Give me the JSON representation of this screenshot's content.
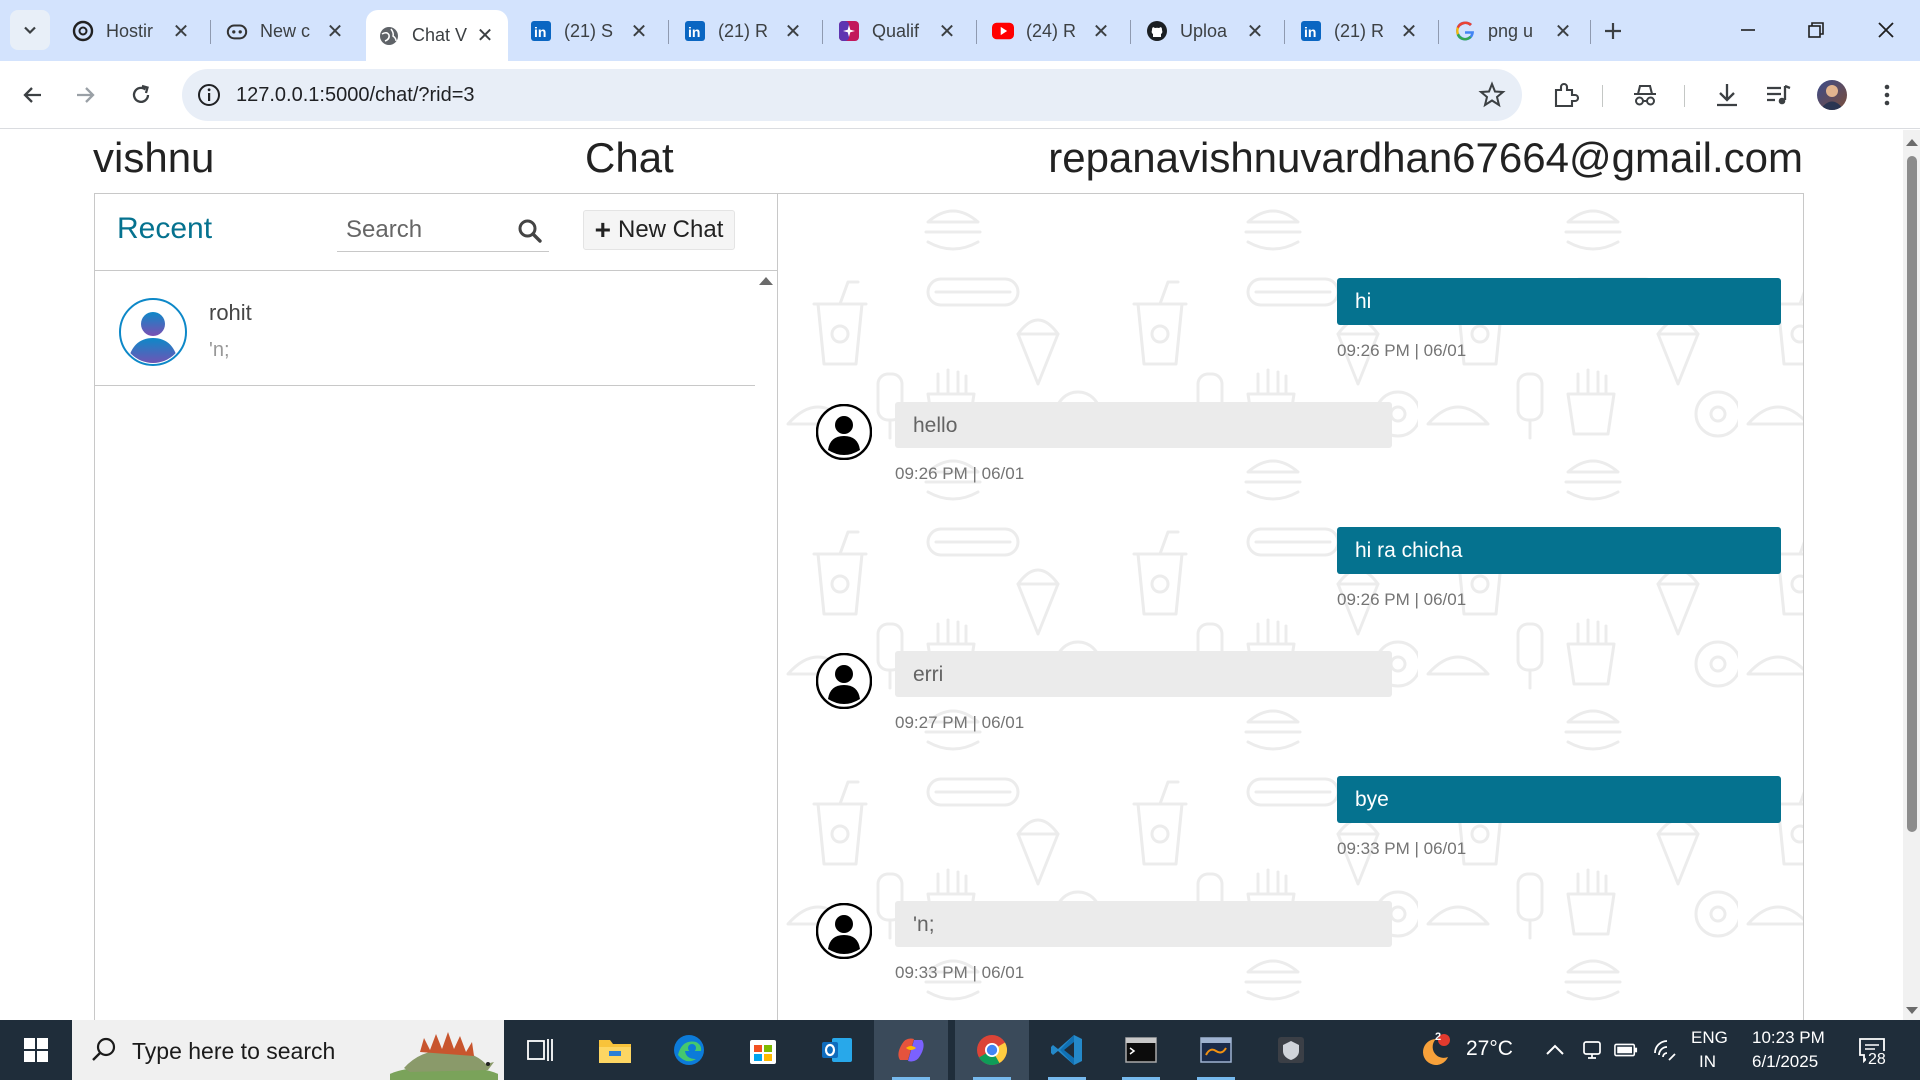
{
  "browser": {
    "tabs": [
      {
        "title": "Hostir",
        "icon": "openai-icon"
      },
      {
        "title": "New c",
        "icon": "copilot-icon"
      },
      {
        "title": "Chat V",
        "icon": "globe-icon",
        "active": true
      },
      {
        "title": "(21) S",
        "icon": "linkedin-icon"
      },
      {
        "title": "(21) R",
        "icon": "linkedin-icon"
      },
      {
        "title": "Qualif",
        "icon": "sparkle-icon"
      },
      {
        "title": "(24) R",
        "icon": "youtube-icon"
      },
      {
        "title": "Uploa",
        "icon": "github-icon"
      },
      {
        "title": "(21) R",
        "icon": "linkedin-icon"
      },
      {
        "title": "png u",
        "icon": "google-icon"
      }
    ],
    "url": "127.0.0.1:5000/chat/?rid=3"
  },
  "page": {
    "username": "vishnu",
    "title": "Chat",
    "email": "repanavishnuvardhan67664@gmail.com"
  },
  "sidebar": {
    "heading": "Recent",
    "search_placeholder": "Search",
    "new_chat_label": "New Chat",
    "chats": [
      {
        "name": "rohit",
        "preview": "'n;"
      }
    ]
  },
  "messages": [
    {
      "direction": "out",
      "text": "hi",
      "time": "09:26 PM | 06/01"
    },
    {
      "direction": "in",
      "text": "hello",
      "time": "09:26 PM | 06/01"
    },
    {
      "direction": "out",
      "text": "hi ra chicha",
      "time": "09:26 PM | 06/01"
    },
    {
      "direction": "in",
      "text": "erri",
      "time": "09:27 PM | 06/01"
    },
    {
      "direction": "out",
      "text": "bye",
      "time": "09:33 PM | 06/01"
    },
    {
      "direction": "in",
      "text": "'n;",
      "time": "09:33 PM | 06/01"
    }
  ],
  "taskbar": {
    "search_placeholder": "Type here to search",
    "weather_badge": "2",
    "temperature": "27°C",
    "language_line1": "ENG",
    "language_line2": "IN",
    "time": "10:23 PM",
    "date": "6/1/2025",
    "notification_count": "28"
  },
  "colors": {
    "accent": "#05728f",
    "incoming_bubble": "#ebebeb",
    "tabstrip": "#d3e3fd",
    "taskbar": "#1f2d3a"
  }
}
